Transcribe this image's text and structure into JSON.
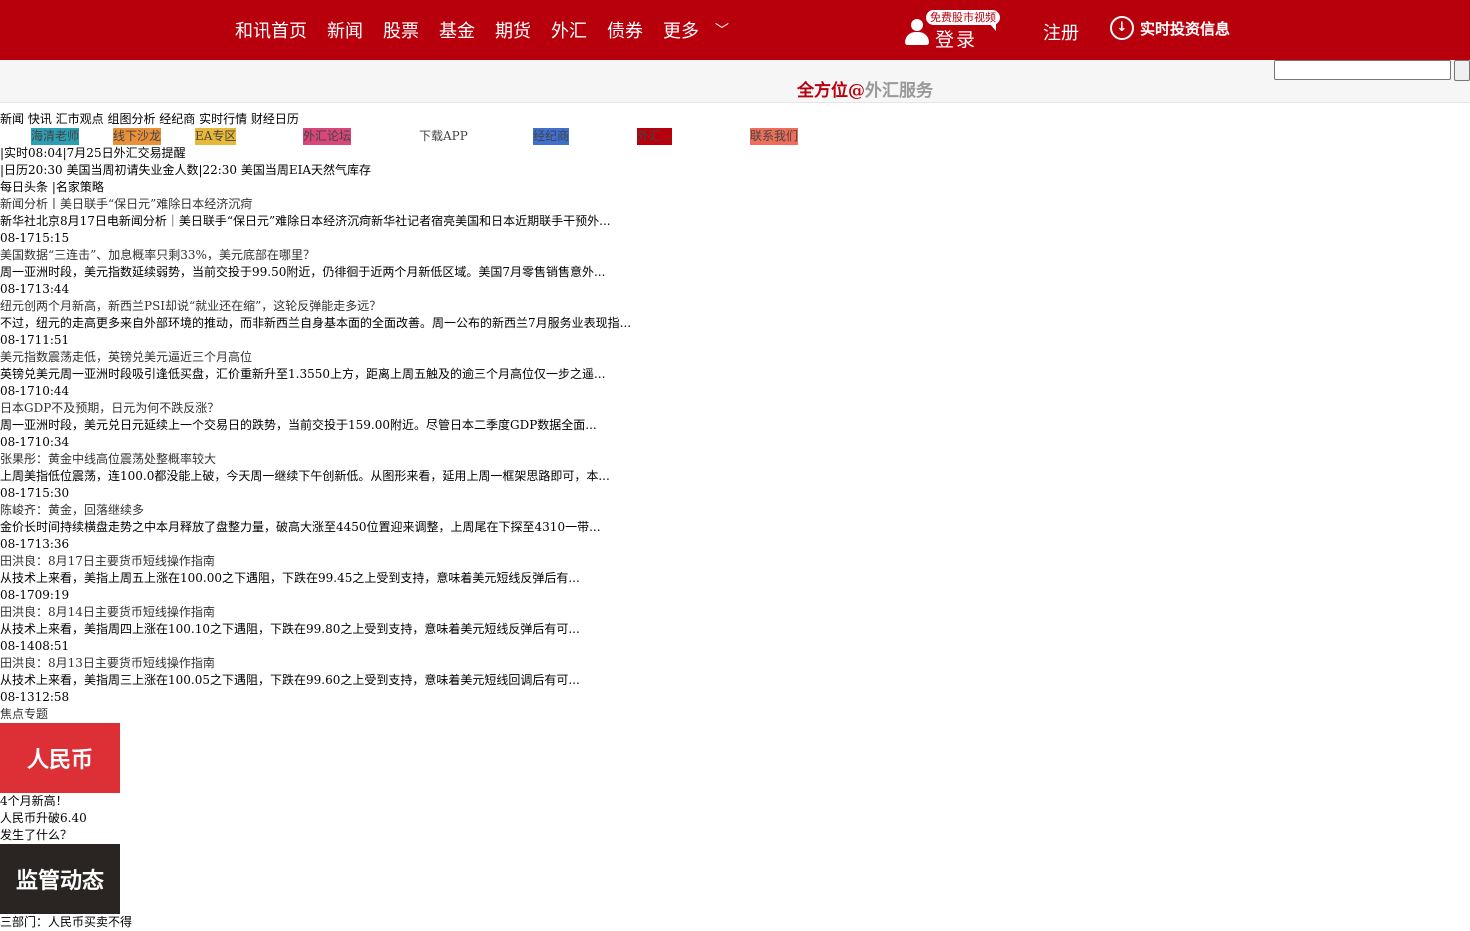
{
  "nav": {
    "items": [
      "和讯首页",
      "新闻",
      "股票",
      "基金",
      "期货",
      "外汇",
      "债券",
      "更多"
    ],
    "login_badge": "免费股市视频",
    "login_label": "登录",
    "register": "注册",
    "realtime": "实时投资信息"
  },
  "slogan": {
    "part1": "全方位@",
    "part2": "外汇服务"
  },
  "subnav": "新闻 快讯 汇市观点 组图分析 经纪商 实时行情 财经日历",
  "quick_links": [
    {
      "label": "海清老师",
      "color": "#2c9fb5"
    },
    {
      "label": "线下沙龙",
      "color": "#e8913a"
    },
    {
      "label": "EA专区",
      "color": "#e8b83a"
    },
    {
      "label": "外汇论坛",
      "color": "#d9467a"
    },
    {
      "label": "下载APP",
      "color": ""
    },
    {
      "label": "经纪商",
      "color": "#3e6fd1"
    },
    {
      "label": "外汇...",
      "color": "#b8000d"
    },
    {
      "label": "联系我们",
      "color": "#ef6e5a"
    }
  ],
  "alerts": {
    "realtime": "|实时08:04|7月25日外汇交易提醒",
    "calendar": "|日历20:30 美国当周初请失业金人数|22:30 美国当周EIA天然气库存",
    "tabs": "每日头条 |名家策略"
  },
  "news": [
    {
      "title": "新闻分析丨美日联手“保日元”难除日本经济沉疴",
      "summary": "新华社北京8月17日电新闻分析｜美日联手“保日元”难除日本经济沉疴新华社记者宿亮美国和日本近期联手干预外...",
      "time": "08-1715:15"
    },
    {
      "title": "美国数据“三连击”、加息概率只剩33%，美元底部在哪里？",
      "summary": "周一亚洲时段，美元指数延续弱势，当前交投于99.50附近，仍徘徊于近两个月新低区域。美国7月零售销售意外...",
      "time": "08-1713:44"
    },
    {
      "title": "纽元创两个月新高，新西兰PSI却说“就业还在缩”，这轮反弹能走多远？",
      "summary": "不过，纽元的走高更多来自外部环境的推动，而非新西兰自身基本面的全面改善。周一公布的新西兰7月服务业表现指...",
      "time": "08-1711:51"
    },
    {
      "title": "美元指数震荡走低，英镑兑美元逼近三个月高位",
      "summary": "英镑兑美元周一亚洲时段吸引逢低买盘，汇价重新升至1.3550上方，距离上周五触及的逾三个月高位仅一步之遥...",
      "time": "08-1710:44"
    },
    {
      "title": "日本GDP不及预期，日元为何不跌反涨？",
      "summary": "周一亚洲时段，美元兑日元延续上一个交易日的跌势，当前交投于159.00附近。尽管日本二季度GDP数据全面...",
      "time": "08-1710:34"
    },
    {
      "title": "张果彤：黄金中线高位震荡处整概率较大",
      "summary": "上周美指低位震荡，连100.0都没能上破，今天周一继续下午创新低。从图形来看，延用上周一框架思路即可，本...",
      "time": "08-1715:30"
    },
    {
      "title": "陈峻齐：黄金，回落继续多",
      "summary": "金价长时间持续横盘走势之中本月释放了盘整力量，破高大涨至4450位置迎来调整，上周尾在下探至4310一带...",
      "time": "08-1713:36"
    },
    {
      "title": "田洪良：8月17日主要货币短线操作指南",
      "summary": "从技术上来看，美指上周五上涨在100.00之下遇阻，下跌在99.45之上受到支持，意味着美元短线反弹后有...",
      "time": "08-1709:19"
    },
    {
      "title": "田洪良：8月14日主要货币短线操作指南",
      "summary": "从技术上来看，美指周四上涨在100.10之下遇阻，下跌在99.80之上受到支持，意味着美元短线反弹后有可...",
      "time": "08-1408:51"
    },
    {
      "title": "田洪良：8月13日主要货币短线操作指南",
      "summary": "从技术上来看，美指周三上涨在100.05之下遇阻，下跌在99.60之上受到支持，意味着美元短线回调后有可...",
      "time": "08-1312:58"
    }
  ],
  "focus": {
    "heading": "焦点专题",
    "card1": {
      "image_text": "人民币",
      "lines": [
        "4个月新高！",
        "人民币升破6.40",
        "发生了什么？"
      ]
    },
    "card2": {
      "image_text": "监管动态",
      "lines": [
        "三部门：人民币买卖不得"
      ]
    }
  },
  "colors": {
    "brand_red": "#b8000d"
  }
}
